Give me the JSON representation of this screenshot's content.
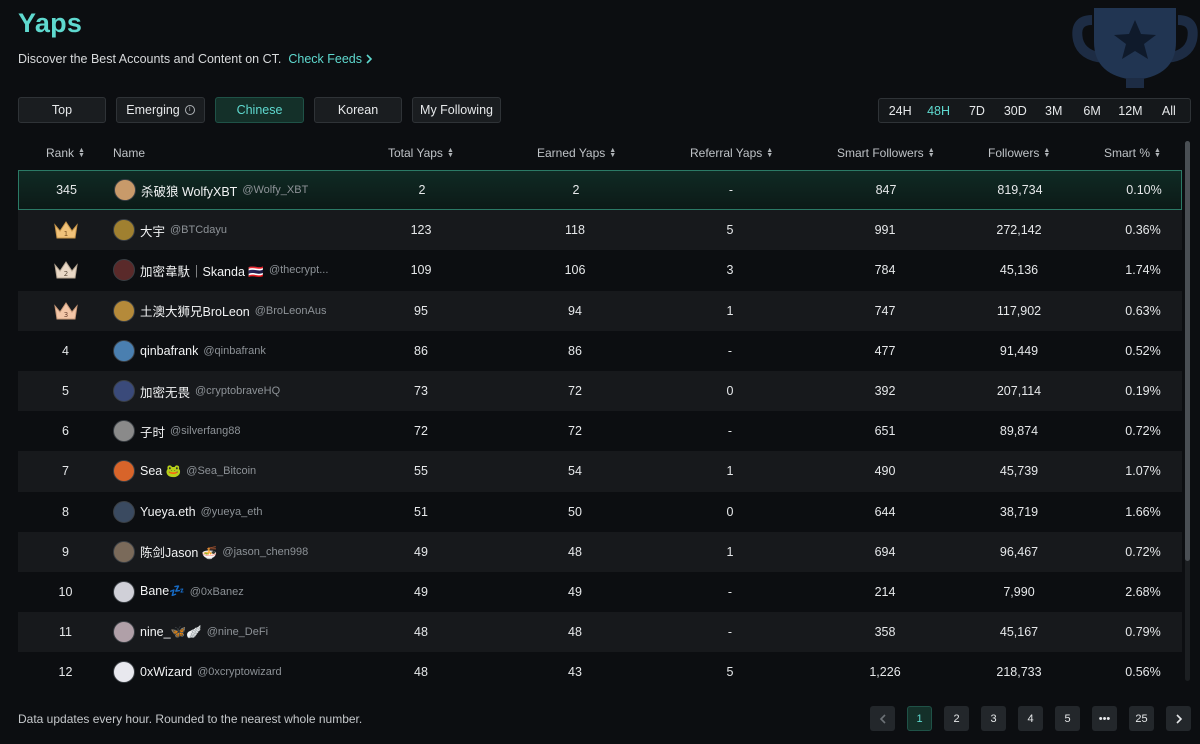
{
  "header": {
    "title": "Yaps",
    "subtitle": "Discover the Best Accounts and Content on CT.",
    "check_feeds": "Check Feeds"
  },
  "category_tabs": [
    {
      "label": "Top",
      "active": false
    },
    {
      "label": "Emerging",
      "active": false,
      "info": true
    },
    {
      "label": "Chinese",
      "active": true
    },
    {
      "label": "Korean",
      "active": false
    },
    {
      "label": "My Following",
      "active": false
    }
  ],
  "time_tabs": [
    {
      "label": "24H",
      "active": false
    },
    {
      "label": "48H",
      "active": true
    },
    {
      "label": "7D",
      "active": false
    },
    {
      "label": "30D",
      "active": false
    },
    {
      "label": "3M",
      "active": false
    },
    {
      "label": "6M",
      "active": false
    },
    {
      "label": "12M",
      "active": false
    },
    {
      "label": "All",
      "active": false
    }
  ],
  "columns": {
    "rank": "Rank",
    "name": "Name",
    "total": "Total Yaps",
    "earned": "Earned Yaps",
    "referral": "Referral Yaps",
    "smart": "Smart Followers",
    "followers": "Followers",
    "pct": "Smart %"
  },
  "current_user": {
    "rank": "345",
    "name": "杀破狼 WolfyXBT",
    "handle": "@Wolfy_XBT",
    "total": "2",
    "earned": "2",
    "referral": "-",
    "smart": "847",
    "followers": "819,734",
    "pct": "0.10%",
    "avatar_color": "#c89a6a"
  },
  "rows": [
    {
      "rank": "1",
      "crown": "gold",
      "name": "大宇",
      "handle": "@BTCdayu",
      "total": "123",
      "earned": "118",
      "referral": "5",
      "smart": "991",
      "followers": "272,142",
      "pct": "0.36%",
      "avatar_color": "#a08030"
    },
    {
      "rank": "2",
      "crown": "silver",
      "name": "加密韋馱｜Skanda 🇹🇭",
      "handle": "@thecrypt...",
      "total": "109",
      "earned": "106",
      "referral": "3",
      "smart": "784",
      "followers": "45,136",
      "pct": "1.74%",
      "avatar_color": "#5a2a2a"
    },
    {
      "rank": "3",
      "crown": "bronze",
      "name": "土澳大狮兄BroLeon",
      "handle": "@BroLeonAus",
      "total": "95",
      "earned": "94",
      "referral": "1",
      "smart": "747",
      "followers": "117,902",
      "pct": "0.63%",
      "avatar_color": "#b58a3a"
    },
    {
      "rank": "4",
      "name": "qinbafrank",
      "handle": "@qinbafrank",
      "total": "86",
      "earned": "86",
      "referral": "-",
      "smart": "477",
      "followers": "91,449",
      "pct": "0.52%",
      "avatar_color": "#4a7fb0"
    },
    {
      "rank": "5",
      "name": "加密无畏",
      "handle": "@cryptobraveHQ",
      "total": "73",
      "earned": "72",
      "referral": "0",
      "smart": "392",
      "followers": "207,114",
      "pct": "0.19%",
      "avatar_color": "#3a4a7a"
    },
    {
      "rank": "6",
      "name": "子时",
      "handle": "@silverfang88",
      "total": "72",
      "earned": "72",
      "referral": "-",
      "smart": "651",
      "followers": "89,874",
      "pct": "0.72%",
      "avatar_color": "#8a8a8a"
    },
    {
      "rank": "7",
      "name": "Sea 🐸",
      "handle": "@Sea_Bitcoin",
      "total": "55",
      "earned": "54",
      "referral": "1",
      "smart": "490",
      "followers": "45,739",
      "pct": "1.07%",
      "avatar_color": "#d8642a"
    },
    {
      "rank": "8",
      "name": "Yueya.eth",
      "handle": "@yueya_eth",
      "total": "51",
      "earned": "50",
      "referral": "0",
      "smart": "644",
      "followers": "38,719",
      "pct": "1.66%",
      "avatar_color": "#3a4a60"
    },
    {
      "rank": "9",
      "name": "陈剑Jason 🍜",
      "handle": "@jason_chen998",
      "total": "49",
      "earned": "48",
      "referral": "1",
      "smart": "694",
      "followers": "96,467",
      "pct": "0.72%",
      "avatar_color": "#7a6a5a"
    },
    {
      "rank": "10",
      "name": "Bane💤",
      "handle": "@0xBanez",
      "total": "49",
      "earned": "49",
      "referral": "-",
      "smart": "214",
      "followers": "7,990",
      "pct": "2.68%",
      "avatar_color": "#d0d0d8"
    },
    {
      "rank": "11",
      "name": "nine_🦋🪽",
      "handle": "@nine_DeFi",
      "total": "48",
      "earned": "48",
      "referral": "-",
      "smart": "358",
      "followers": "45,167",
      "pct": "0.79%",
      "avatar_color": "#b0a0a8"
    },
    {
      "rank": "12",
      "name": "0xWizard",
      "handle": "@0xcryptowizard",
      "total": "48",
      "earned": "43",
      "referral": "5",
      "smart": "1,226",
      "followers": "218,733",
      "pct": "0.56%",
      "avatar_color": "#e8e8ee"
    }
  ],
  "footer": {
    "note": "Data updates every hour. Rounded to the nearest whole number.",
    "pages": [
      "1",
      "2",
      "3",
      "4",
      "5",
      "•••",
      "25"
    ],
    "current_page": "1"
  },
  "colors": {
    "accent": "#5fd9cf",
    "background": "#0c0e11",
    "gold": "#f0c27a",
    "silver": "#e9d8c6",
    "bronze": "#f3c6a8"
  }
}
